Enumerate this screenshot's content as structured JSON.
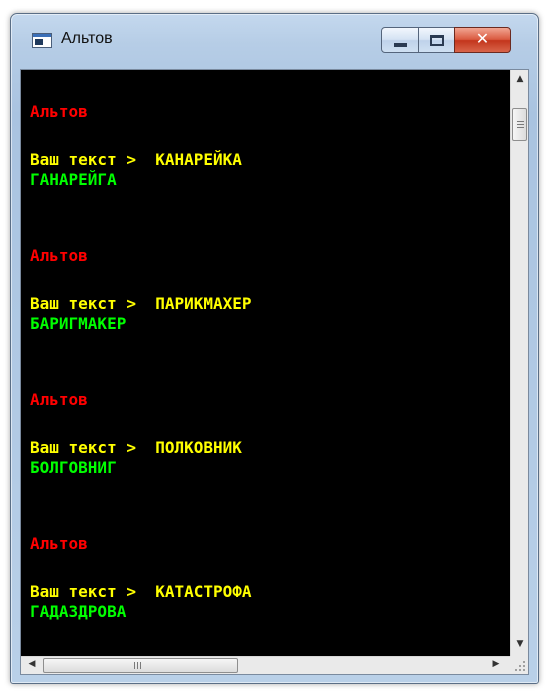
{
  "window": {
    "title": "Альтов",
    "icon": "console-window-icon",
    "controls": {
      "minimize": "minimize-icon",
      "maximize": "maximize-icon",
      "close": "✕"
    }
  },
  "console": {
    "entries": [
      {
        "name": "Альтов",
        "prompt": "Ваш текст >",
        "input": "КАНАРЕЙКА",
        "output": "ГАНАРЕЙГА"
      },
      {
        "name": "Альтов",
        "prompt": "Ваш текст >",
        "input": "ПАРИКМАХЕР",
        "output": "БАРИГМАКЕР"
      },
      {
        "name": "Альтов",
        "prompt": "Ваш текст >",
        "input": "ПОЛКОВНИК",
        "output": "БОЛГОВНИГ"
      },
      {
        "name": "Альтов",
        "prompt": "Ваш текст >",
        "input": "КАТАСТРОФА",
        "output": "ГАДАЗДРОВА"
      }
    ],
    "colors": {
      "background": "#000000",
      "name": "#ff0000",
      "prompt": "#ffff00",
      "output": "#00ff00"
    }
  },
  "scrollbars": {
    "up": "▲",
    "down": "▼",
    "left": "◀",
    "right": "▶"
  }
}
